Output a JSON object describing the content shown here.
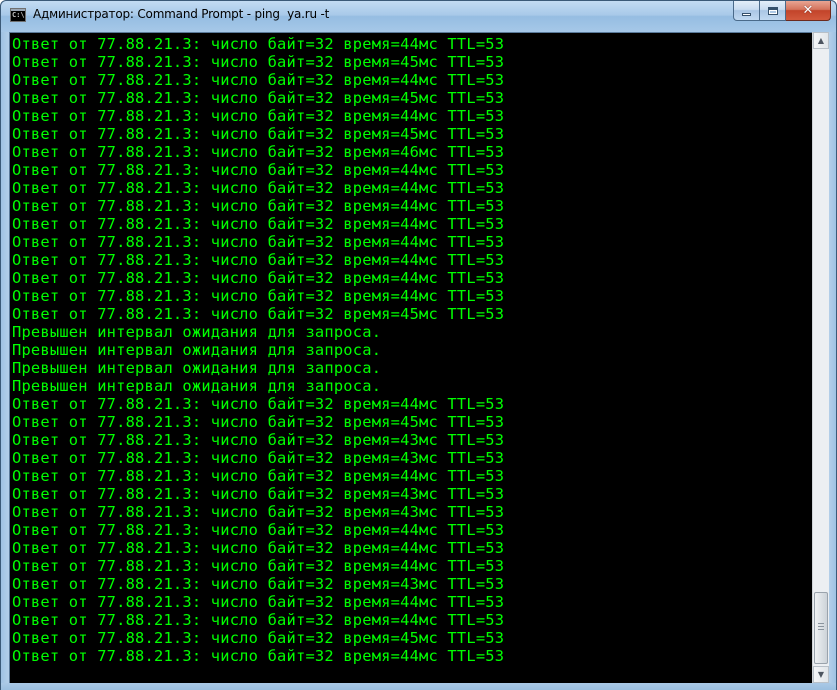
{
  "window": {
    "title": "Администратор: Command Prompt - ping  ya.ru -t",
    "icon_text": "C:\\"
  },
  "caption_buttons": {
    "minimize": "minimize-icon",
    "maximize": "maximize-icon",
    "close": "✕"
  },
  "console": {
    "text_color": "#00ff00",
    "background": "#000000",
    "lines": [
      "Ответ от 77.88.21.3: число байт=32 время=44мс TTL=53",
      "Ответ от 77.88.21.3: число байт=32 время=45мс TTL=53",
      "Ответ от 77.88.21.3: число байт=32 время=44мс TTL=53",
      "Ответ от 77.88.21.3: число байт=32 время=45мс TTL=53",
      "Ответ от 77.88.21.3: число байт=32 время=44мс TTL=53",
      "Ответ от 77.88.21.3: число байт=32 время=45мс TTL=53",
      "Ответ от 77.88.21.3: число байт=32 время=46мс TTL=53",
      "Ответ от 77.88.21.3: число байт=32 время=44мс TTL=53",
      "Ответ от 77.88.21.3: число байт=32 время=44мс TTL=53",
      "Ответ от 77.88.21.3: число байт=32 время=44мс TTL=53",
      "Ответ от 77.88.21.3: число байт=32 время=44мс TTL=53",
      "Ответ от 77.88.21.3: число байт=32 время=44мс TTL=53",
      "Ответ от 77.88.21.3: число байт=32 время=44мс TTL=53",
      "Ответ от 77.88.21.3: число байт=32 время=44мс TTL=53",
      "Ответ от 77.88.21.3: число байт=32 время=44мс TTL=53",
      "Ответ от 77.88.21.3: число байт=32 время=45мс TTL=53",
      "Превышен интервал ожидания для запроса.",
      "Превышен интервал ожидания для запроса.",
      "Превышен интервал ожидания для запроса.",
      "Превышен интервал ожидания для запроса.",
      "Ответ от 77.88.21.3: число байт=32 время=44мс TTL=53",
      "Ответ от 77.88.21.3: число байт=32 время=45мс TTL=53",
      "Ответ от 77.88.21.3: число байт=32 время=43мс TTL=53",
      "Ответ от 77.88.21.3: число байт=32 время=43мс TTL=53",
      "Ответ от 77.88.21.3: число байт=32 время=44мс TTL=53",
      "Ответ от 77.88.21.3: число байт=32 время=43мс TTL=53",
      "Ответ от 77.88.21.3: число байт=32 время=43мс TTL=53",
      "Ответ от 77.88.21.3: число байт=32 время=44мс TTL=53",
      "Ответ от 77.88.21.3: число байт=32 время=44мс TTL=53",
      "Ответ от 77.88.21.3: число байт=32 время=44мс TTL=53",
      "Ответ от 77.88.21.3: число байт=32 время=43мс TTL=53",
      "Ответ от 77.88.21.3: число байт=32 время=44мс TTL=53",
      "Ответ от 77.88.21.3: число байт=32 время=44мс TTL=53",
      "Ответ от 77.88.21.3: число байт=32 время=45мс TTL=53",
      "Ответ от 77.88.21.3: число байт=32 время=44мс TTL=53"
    ]
  },
  "scrollbar": {
    "up": "▲",
    "down": "▼"
  }
}
